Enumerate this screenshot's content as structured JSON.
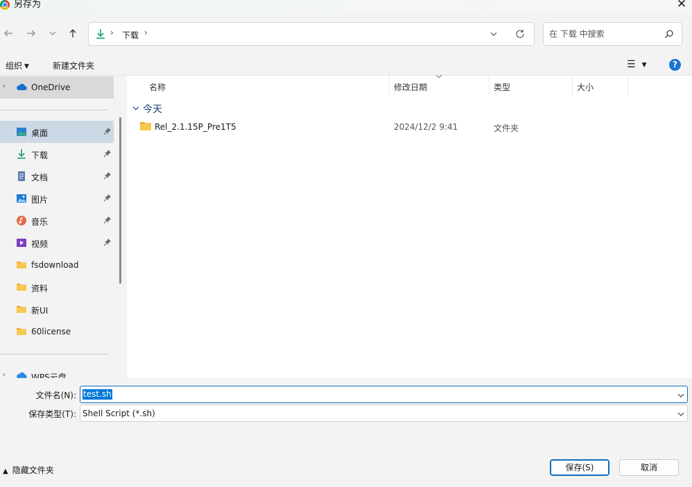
{
  "window": {
    "title": "另存为",
    "close_label": "✕"
  },
  "nav": {
    "address": {
      "crumbs": [
        "下载"
      ]
    },
    "search": {
      "placeholder": "在 下载 中搜索"
    }
  },
  "commands": {
    "organize": "组织",
    "new_folder": "新建文件夹",
    "help": "?"
  },
  "sidebar": {
    "items": [
      {
        "label": "OneDrive",
        "icon": "cloud-icon"
      },
      {
        "label": "桌面",
        "icon": "desktop-icon",
        "pinned": true
      },
      {
        "label": "下载",
        "icon": "download-icon",
        "pinned": true
      },
      {
        "label": "文档",
        "icon": "document-icon",
        "pinned": true
      },
      {
        "label": "图片",
        "icon": "image-icon",
        "pinned": true
      },
      {
        "label": "音乐",
        "icon": "music-icon",
        "pinned": true
      },
      {
        "label": "视频",
        "icon": "video-icon",
        "pinned": true
      },
      {
        "label": "fsdownload",
        "icon": "folder-icon"
      },
      {
        "label": "资料",
        "icon": "folder-icon"
      },
      {
        "label": "新UI",
        "icon": "folder-icon"
      },
      {
        "label": "60license",
        "icon": "folder-icon"
      },
      {
        "label": "WPS云盘",
        "icon": "cloud-icon"
      }
    ]
  },
  "columns": [
    "名称",
    "修改日期",
    "类型",
    "大小"
  ],
  "groups": [
    {
      "label": "今天",
      "rows": [
        {
          "name": "Rel_2.1.15P_Pre1T5",
          "modified": "2024/12/2 9:41",
          "type": "文件夹",
          "size": ""
        }
      ]
    }
  ],
  "save": {
    "filename_label": "文件名(N):",
    "filename_value": "test.sh",
    "filetype_label": "保存类型(T):",
    "filetype_value": "Shell Script (*.sh)",
    "hide_folders": "隐藏文件夹",
    "save_button": "保存(S)",
    "cancel_button": "取消"
  },
  "colors": {
    "accent": "#0f6cbd",
    "selection": "#0078d7",
    "folder": "#f2c14e",
    "group_text": "#1e3f7a"
  }
}
